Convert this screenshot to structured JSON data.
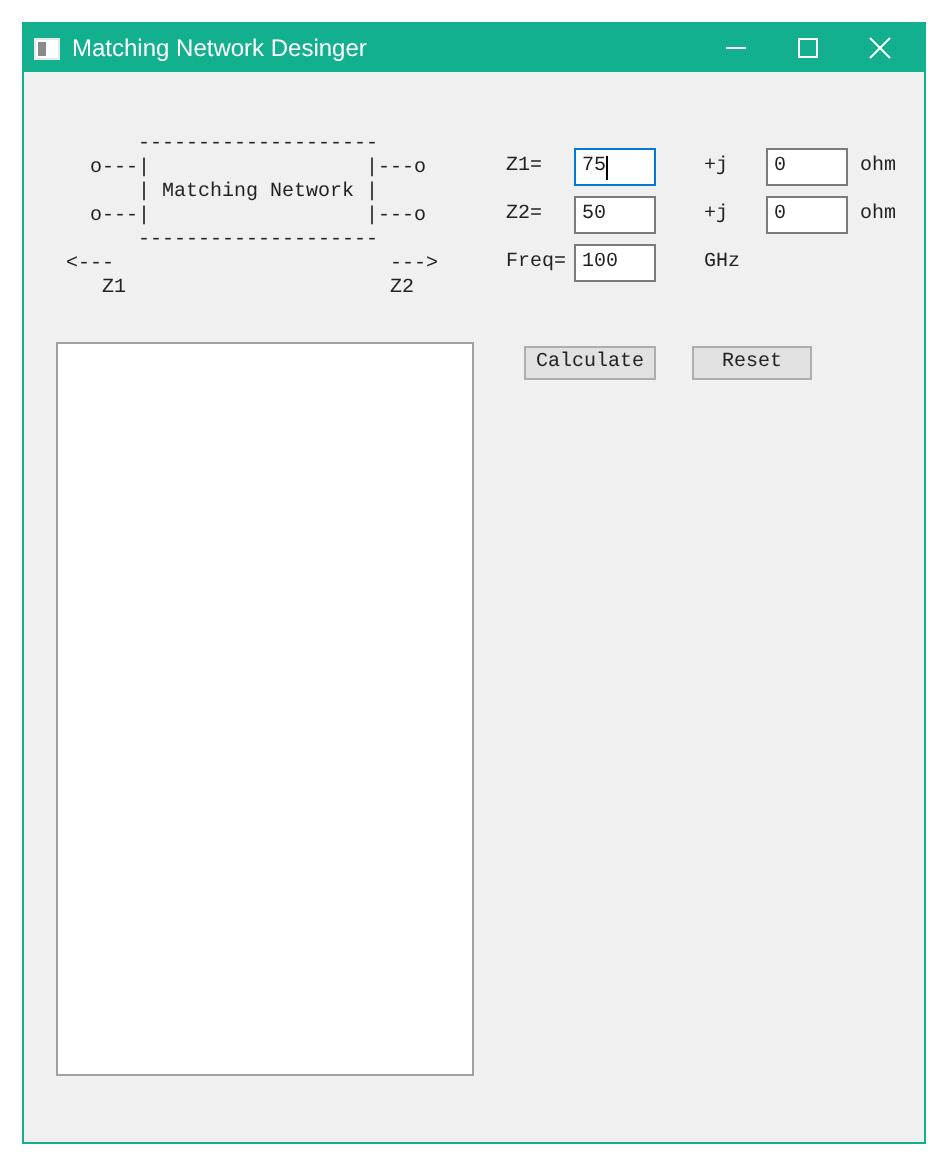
{
  "window": {
    "title": "Matching Network Desinger"
  },
  "diagram": {
    "lines": [
      "      --------------------",
      "  o---|                  |---o",
      "      | Matching Network |",
      "  o---|                  |---o",
      "      --------------------",
      "<---                       --->",
      "   Z1                      Z2"
    ]
  },
  "fields": [
    {
      "kind": "complex",
      "label": "Z1=",
      "value": "75",
      "focused": true,
      "imag_label": "+j",
      "imag_value": "0",
      "unit": "ohm"
    },
    {
      "kind": "complex",
      "label": "Z2=",
      "value": "50",
      "focused": false,
      "imag_label": "+j",
      "imag_value": "0",
      "unit": "ohm"
    },
    {
      "kind": "real",
      "label": "Freq=",
      "value": "100",
      "focused": false,
      "unit": "GHz"
    }
  ],
  "buttons": [
    "Calculate",
    "Reset"
  ]
}
